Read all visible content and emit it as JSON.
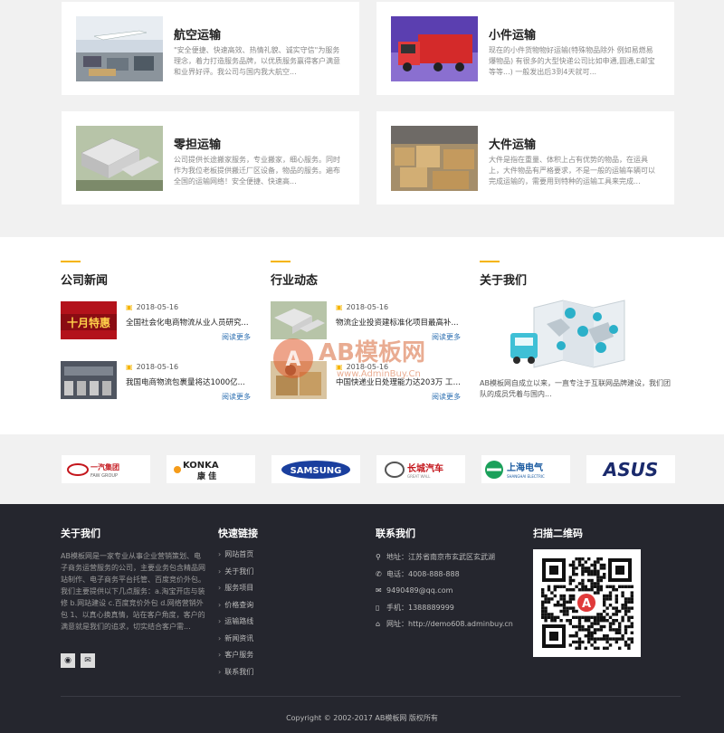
{
  "services": [
    {
      "title": "航空运输",
      "desc": "\"安全便捷、快速高效、热情礼貌、诚实守信\"为服务理念，着力打造服务品牌，以优质服务赢得客户满意和业界好评。我公司与国内我大航空..."
    },
    {
      "title": "小件运输",
      "desc": "现在的小件货物物好运输(特殊物品除外 例如易燃易爆物品) 有很多的大型快递公司比如申通,圆通,E邮宝等等...) 一般发出后3到4天就可..."
    },
    {
      "title": "零担运输",
      "desc": "公司提供长途搬家服务，专业搬家，细心服务。同时作为我位老板提供搬迁厂区设备，物品的服务。遍布全国的运输网络！安全便捷、快速高..."
    },
    {
      "title": "大件运输",
      "desc": "大件是指在重量、体积上占有优势的物品，在运具上，大件物品有严格要求，不是一般的运输车辆可以完成运输的，需要用到特种的运输工具来完成..."
    }
  ],
  "news": {
    "company": {
      "heading": "公司新闻",
      "items": [
        {
          "date": "2018-05-16",
          "title": "全国社会化电商物流从业人员研究...",
          "more": "阅读更多"
        },
        {
          "date": "2018-05-16",
          "title": "我国电商物流包裹量将达1000亿...",
          "more": "阅读更多"
        }
      ]
    },
    "industry": {
      "heading": "行业动态",
      "items": [
        {
          "date": "2018-05-16",
          "title": "物流企业投资建标准化项目最高补...",
          "more": "阅读更多"
        },
        {
          "date": "2018-05-16",
          "title": "中国快递业日处理能力达203万 工作...",
          "more": "阅读更多"
        }
      ]
    },
    "about": {
      "heading": "关于我们",
      "text": "AB模板网自成立以来，一直专注于互联网品牌建设，我们团队的成员凭着与国内..."
    }
  },
  "watermark": {
    "text": "AB模板网",
    "url": "www.AdminBuy.Cn"
  },
  "partners": [
    {
      "name": "一汽集团",
      "sub": "FAW GROUP"
    },
    {
      "name": "KONKA",
      "sub": "康佳"
    },
    {
      "name": "SAMSUNG",
      "sub": ""
    },
    {
      "name": "长城汽车",
      "sub": "GREAT WALL"
    },
    {
      "name": "上海电气",
      "sub": "SHANGHAI ELECTRIC"
    },
    {
      "name": "ASUS",
      "sub": ""
    }
  ],
  "footer": {
    "about": {
      "title": "关于我们",
      "text": "AB模板网是一家专业从事企业营销策划、电子商务运营服务的公司，主要业务包含精品网站制作、电子商务平台托管、百度竞价外包。我们主要提供以下几点服务：a.淘宝开店与装修 b.网站建设 c.百度竞价外包 d.网络营销外包 1、以真心换真情，站在客户角度，客户的满意就是我们的追求，切实结合客户需..."
    },
    "links": {
      "title": "快速链接",
      "items": [
        "网站首页",
        "关于我们",
        "服务项目",
        "价格查询",
        "运输路线",
        "新闻资讯",
        "客户服务",
        "联系我们"
      ]
    },
    "contact": {
      "title": "联系我们",
      "address": "地址：江苏省南京市玄武区玄武湖",
      "phone": "电话：4008-888-888",
      "email": "9490489@qq.com",
      "mobile": "手机：1388889999",
      "site": "网址：http://demo608.adminbuy.cn"
    },
    "qr": {
      "title": "扫描二维码"
    },
    "copyright": "Copyright © 2002-2017 AB模板网 版权所有"
  },
  "colors": {
    "accent": "#f5b400",
    "footer_bg": "#25262e",
    "link_blue": "#2a6db0"
  }
}
